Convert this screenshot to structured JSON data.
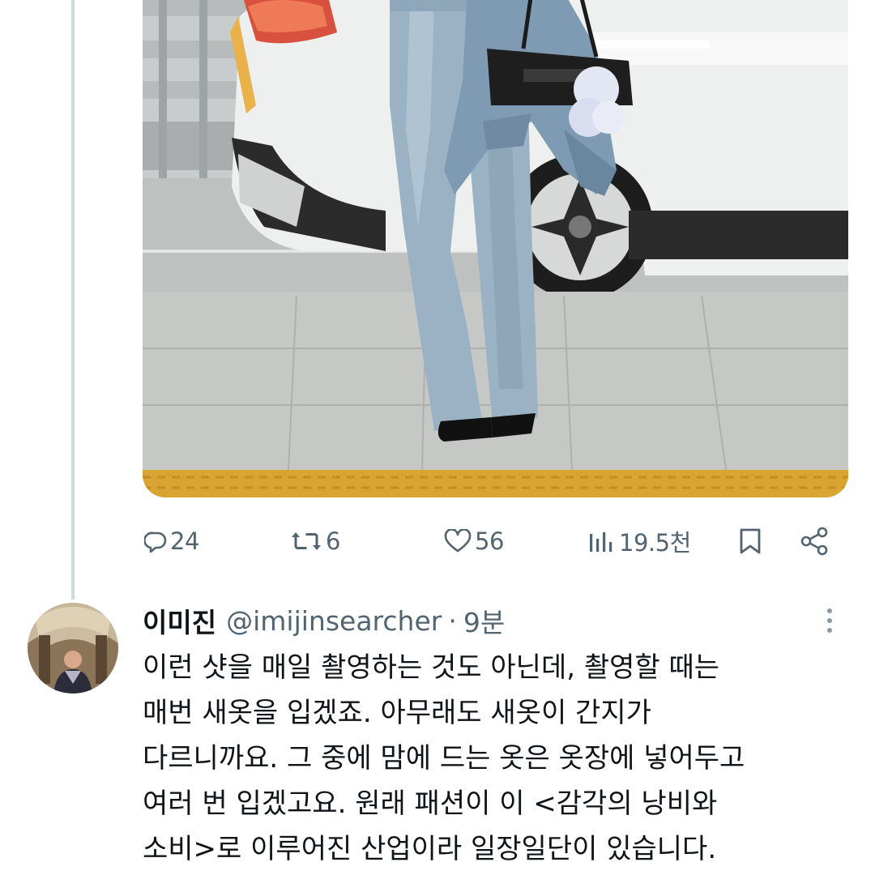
{
  "actions": {
    "reply_count": "24",
    "retweet_count": "6",
    "like_count": "56",
    "view_count": "19.5천"
  },
  "reply_tweet": {
    "display_name": "이미진",
    "handle": "@imijinsearcher",
    "separator": "·",
    "time": "9분",
    "lines": [
      "이런 샷을 매일 촬영하는 것도 아닌데, 촬영할 때는",
      "매번 새옷을 입겠죠. 아무래도 새옷이 간지가",
      "다르니까요. 그 중에 맘에 드는 옷은 옷장에 넣어두고",
      "여러 번 입겠고요. 원래 패션이 이 <감각의 낭비와",
      "소비>로 이루어진 산업이라 일장일단이 있습니다."
    ]
  },
  "icons": [
    "reply-icon",
    "retweet-icon",
    "like-icon",
    "views-icon",
    "bookmark-icon",
    "share-icon",
    "more-icon"
  ],
  "colors": {
    "text_primary": "#0f1419",
    "text_secondary": "#536471",
    "thread_line": "#cfd9de",
    "tactile_paving": "#d9a532"
  }
}
